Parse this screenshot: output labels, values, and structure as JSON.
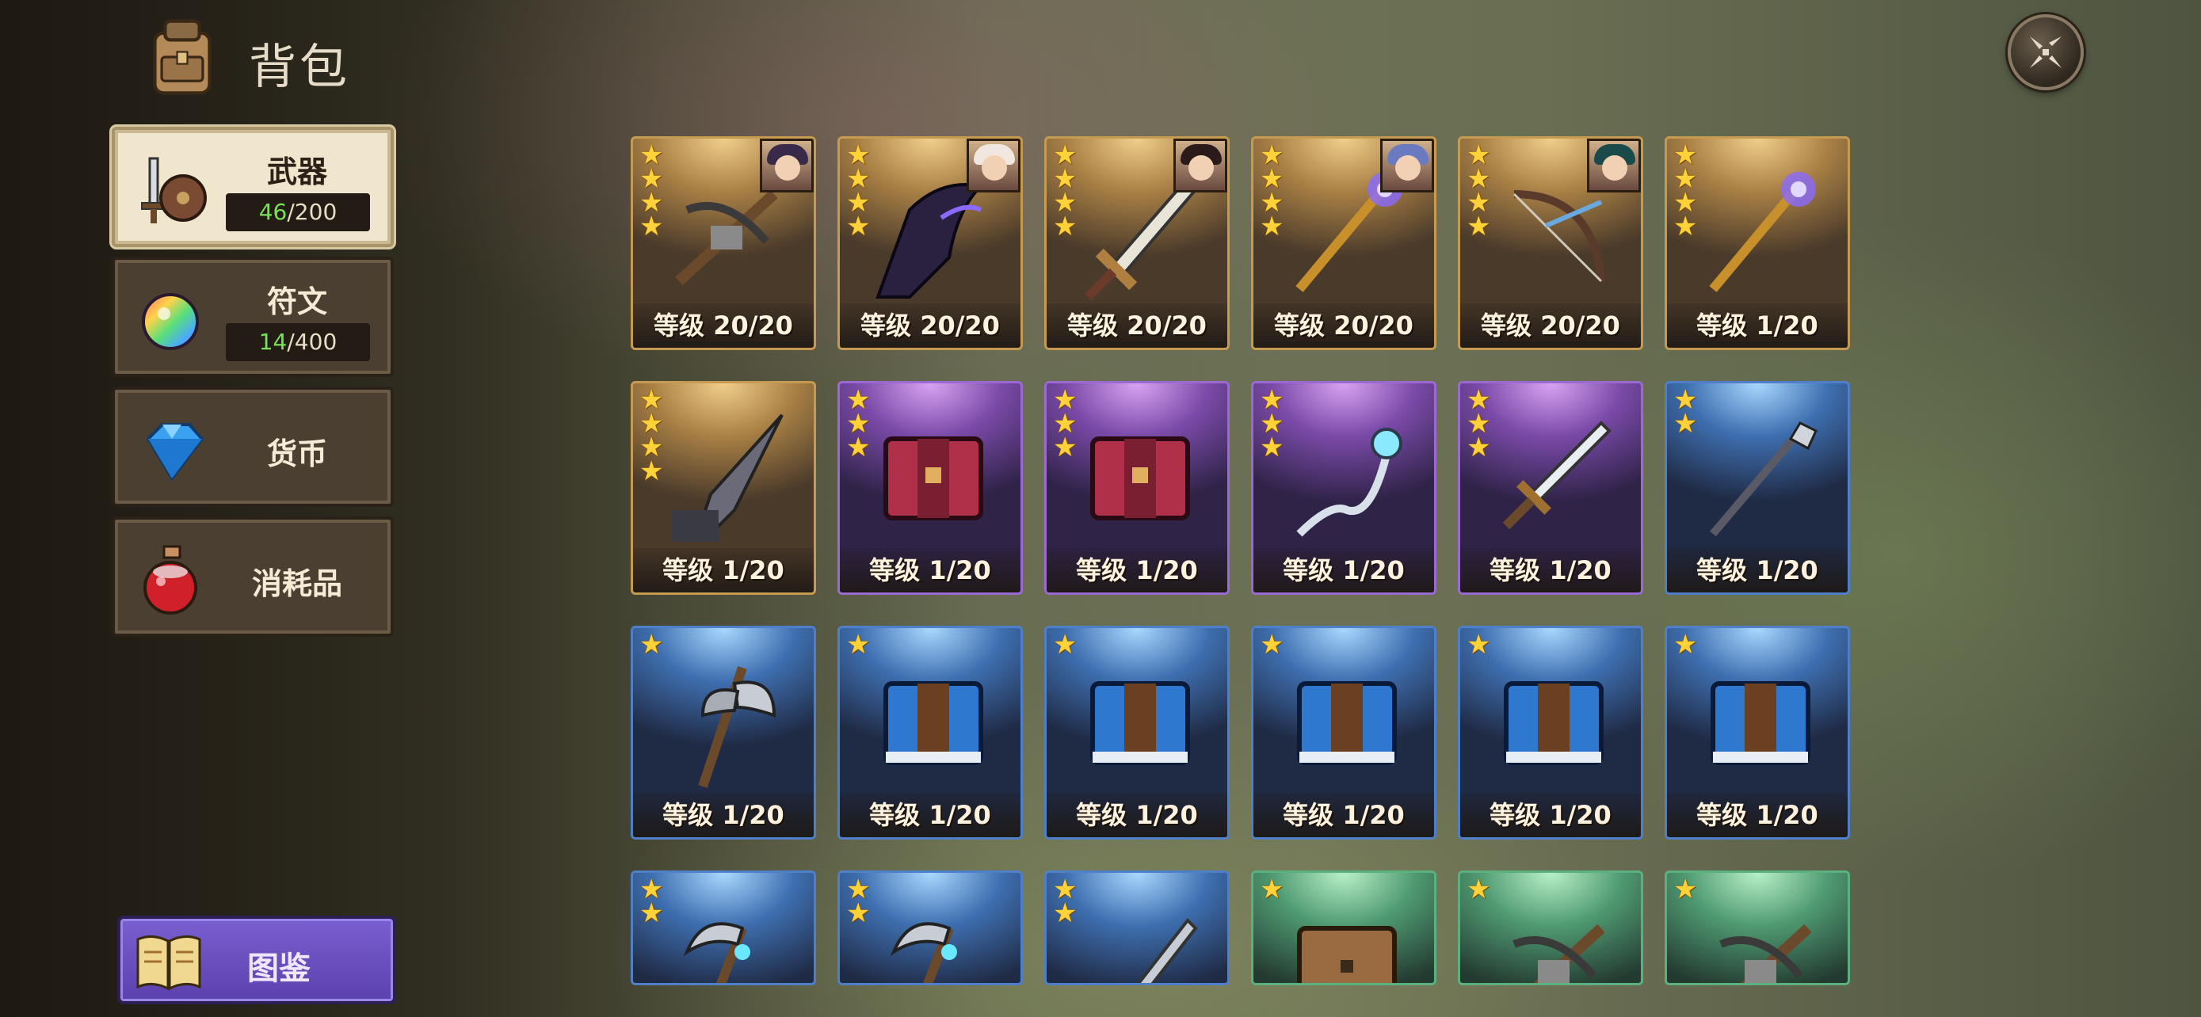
{
  "header": {
    "title": "背包"
  },
  "sidebar": {
    "tabs": [
      {
        "label": "武器",
        "count_current": "46",
        "count_max": "/200",
        "icon": "sword-shield-icon"
      },
      {
        "label": "符文",
        "count_current": "14",
        "count_max": "/400",
        "icon": "rune-gem-icon"
      },
      {
        "label": "货币",
        "icon": "diamond-icon"
      },
      {
        "label": "消耗品",
        "icon": "potion-icon"
      }
    ],
    "atlas_label": "图鉴"
  },
  "grid": {
    "items": [
      {
        "rarity": "gold",
        "stars": 4,
        "level": "等级 20/20",
        "icon": "crossbow-icon",
        "portrait": true
      },
      {
        "rarity": "gold",
        "stars": 4,
        "level": "等级 20/20",
        "icon": "dark-blade-icon",
        "portrait": true
      },
      {
        "rarity": "gold",
        "stars": 4,
        "level": "等级 20/20",
        "icon": "greatsword-icon",
        "portrait": true
      },
      {
        "rarity": "gold",
        "stars": 4,
        "level": "等级 20/20",
        "icon": "staff-icon",
        "portrait": true
      },
      {
        "rarity": "gold",
        "stars": 4,
        "level": "等级 20/20",
        "icon": "bow-icon",
        "portrait": true
      },
      {
        "rarity": "gold",
        "stars": 4,
        "level": "等级 1/20",
        "icon": "staff-icon",
        "portrait": false
      },
      {
        "rarity": "gold",
        "stars": 4,
        "level": "等级 1/20",
        "icon": "lance-icon",
        "portrait": false
      },
      {
        "rarity": "purple",
        "stars": 3,
        "level": "等级 1/20",
        "icon": "red-book-icon",
        "portrait": false
      },
      {
        "rarity": "purple",
        "stars": 3,
        "level": "等级 1/20",
        "icon": "red-book-icon",
        "portrait": false
      },
      {
        "rarity": "purple",
        "stars": 3,
        "level": "等级 1/20",
        "icon": "wand-icon",
        "portrait": false
      },
      {
        "rarity": "purple",
        "stars": 3,
        "level": "等级 1/20",
        "icon": "sword-icon",
        "portrait": false
      },
      {
        "rarity": "blue",
        "stars": 2,
        "level": "等级 1/20",
        "icon": "spear-icon",
        "portrait": false
      },
      {
        "rarity": "blue",
        "stars": 1,
        "level": "等级 1/20",
        "icon": "axe-icon",
        "portrait": false
      },
      {
        "rarity": "blue",
        "stars": 1,
        "level": "等级 1/20",
        "icon": "blue-book-icon",
        "portrait": false
      },
      {
        "rarity": "blue",
        "stars": 1,
        "level": "等级 1/20",
        "icon": "blue-book-icon",
        "portrait": false
      },
      {
        "rarity": "blue",
        "stars": 1,
        "level": "等级 1/20",
        "icon": "blue-book-icon",
        "portrait": false
      },
      {
        "rarity": "blue",
        "stars": 1,
        "level": "等级 1/20",
        "icon": "blue-book-icon",
        "portrait": false
      },
      {
        "rarity": "blue",
        "stars": 1,
        "level": "等级 1/20",
        "icon": "blue-book-icon",
        "portrait": false
      },
      {
        "rarity": "blue",
        "stars": 2,
        "level": "",
        "icon": "scythe-icon",
        "portrait": false
      },
      {
        "rarity": "blue",
        "stars": 2,
        "level": "",
        "icon": "scythe-icon",
        "portrait": false
      },
      {
        "rarity": "blue",
        "stars": 2,
        "level": "",
        "icon": "dagger-icon",
        "portrait": false
      },
      {
        "rarity": "green",
        "stars": 1,
        "level": "",
        "icon": "brown-book-icon",
        "portrait": false
      },
      {
        "rarity": "green",
        "stars": 1,
        "level": "",
        "icon": "crossbow-icon",
        "portrait": false
      },
      {
        "rarity": "green",
        "stars": 1,
        "level": "",
        "icon": "crossbow-icon",
        "portrait": false
      }
    ]
  },
  "colors": {
    "gold": "#c79a52",
    "purple": "#9a6ad0",
    "blue": "#4f7fc8",
    "green": "#5ab07e",
    "count_highlight": "#7be05a"
  }
}
